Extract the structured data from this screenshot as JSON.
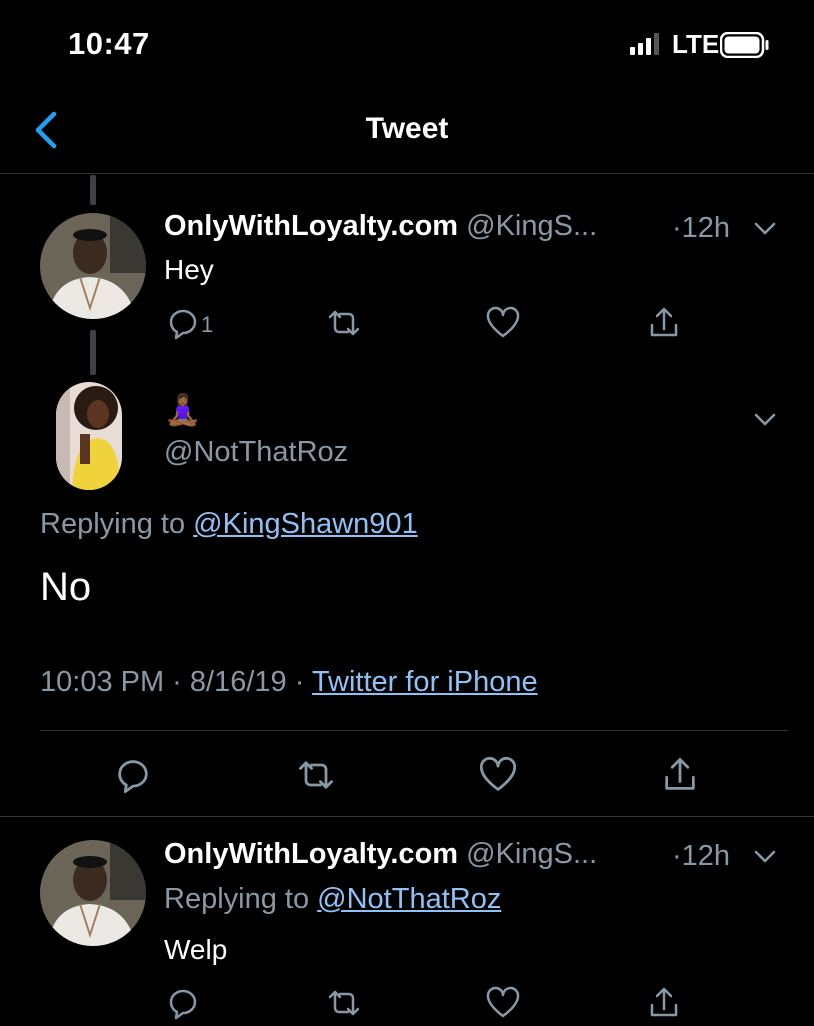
{
  "status_bar": {
    "time": "10:47",
    "network": "LTE"
  },
  "nav": {
    "title": "Tweet"
  },
  "parent_tweet": {
    "display_name": "OnlyWithLoyalty.com",
    "handle": "@KingS...",
    "time_sep": "·",
    "time": "12h",
    "text": "Hey",
    "reply_count": "1"
  },
  "main_tweet": {
    "display_name_emoji": "🧘🏾‍♀️",
    "handle": "@NotThatRoz",
    "replying_prefix": "Replying to",
    "replying_handle": "@KingShawn901",
    "text": "No",
    "timestamp": "10:03 PM · 8/16/19 ·",
    "source": "Twitter for iPhone"
  },
  "reply_tweet": {
    "display_name": "OnlyWithLoyalty.com",
    "handle": "@KingS...",
    "time_sep": "·",
    "time": "12h",
    "replying_prefix": "Replying to",
    "replying_handle": "@NotThatRoz",
    "text": "Welp"
  },
  "colors": {
    "background": "#000000",
    "accent": "#1da1f2",
    "muted": "#8899a6",
    "divider": "#2f3336"
  }
}
